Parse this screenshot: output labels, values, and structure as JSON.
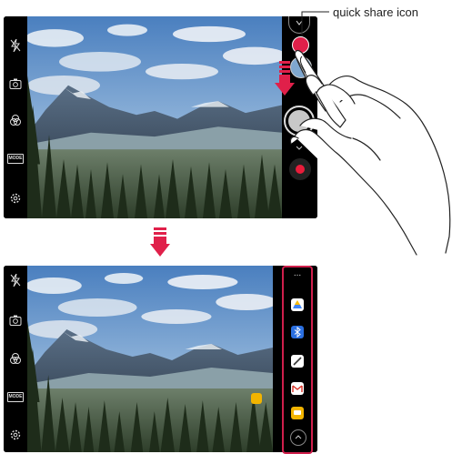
{
  "annotation": {
    "quick_share_label": "quick share icon"
  },
  "camera": {
    "left_toolbar": {
      "icons": [
        "flash-off-icon",
        "switch-camera-icon",
        "filter-icon",
        "mode-icon",
        "settings-icon"
      ],
      "mode_label": "MODE"
    },
    "right_toolbar_top": [
      "quick-share-icon",
      "gallery-thumbnail",
      "shutter-button",
      "record-button"
    ],
    "share_panel": {
      "more_label": "...",
      "apps": [
        {
          "name": "google-drive-icon",
          "color": "#4285f4"
        },
        {
          "name": "bluetooth-icon",
          "color": "#2b6fe0"
        },
        {
          "name": "pen-app-icon",
          "color": "#333333"
        },
        {
          "name": "gmail-icon",
          "color": "#d93025"
        },
        {
          "name": "messages-icon",
          "color": "#f2b400"
        }
      ],
      "collapse": "^"
    }
  },
  "colors": {
    "accent": "#e0204a",
    "record": "#e81c3a",
    "panel_border": "#d01f4c"
  }
}
